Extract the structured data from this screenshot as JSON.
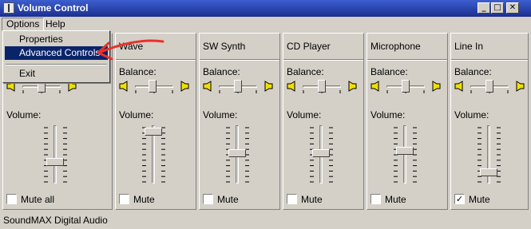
{
  "window": {
    "title": "Volume Control"
  },
  "titlebar_buttons": {
    "minimize": "_",
    "maximize": "□",
    "close": "✕"
  },
  "menu": {
    "options": "Options",
    "help": "Help"
  },
  "options_menu": {
    "items": [
      "Properties",
      "Advanced Controls",
      "Exit"
    ],
    "highlighted": "Advanced Controls"
  },
  "strips": [
    {
      "name": "",
      "balance_label": "",
      "volume_label": "Volume:",
      "mute_label": "Mute all",
      "muted": false,
      "balance": 0.5,
      "volume": 0.35
    },
    {
      "name": "Wave",
      "balance_label": "Balance:",
      "volume_label": "Volume:",
      "mute_label": "Mute",
      "muted": false,
      "balance": 0.45,
      "volume": 0.95
    },
    {
      "name": "SW Synth",
      "balance_label": "Balance:",
      "volume_label": "Volume:",
      "mute_label": "Mute",
      "muted": false,
      "balance": 0.5,
      "volume": 0.52
    },
    {
      "name": "CD Player",
      "balance_label": "Balance:",
      "volume_label": "Volume:",
      "mute_label": "Mute",
      "muted": false,
      "balance": 0.5,
      "volume": 0.52
    },
    {
      "name": "Microphone",
      "balance_label": "Balance:",
      "volume_label": "Volume:",
      "mute_label": "Mute",
      "muted": false,
      "balance": 0.5,
      "volume": 0.57
    },
    {
      "name": "Line In",
      "balance_label": "Balance:",
      "volume_label": "Volume:",
      "mute_label": "Mute",
      "muted": true,
      "balance": 0.5,
      "volume": 0.15
    }
  ],
  "status": {
    "device": "SoundMAX Digital Audio"
  },
  "colors": {
    "face": "#d4d0c8",
    "highlight": "#0a246a",
    "titlebar": "#1b2f8f",
    "annotation_arrow": "#e8332a"
  }
}
